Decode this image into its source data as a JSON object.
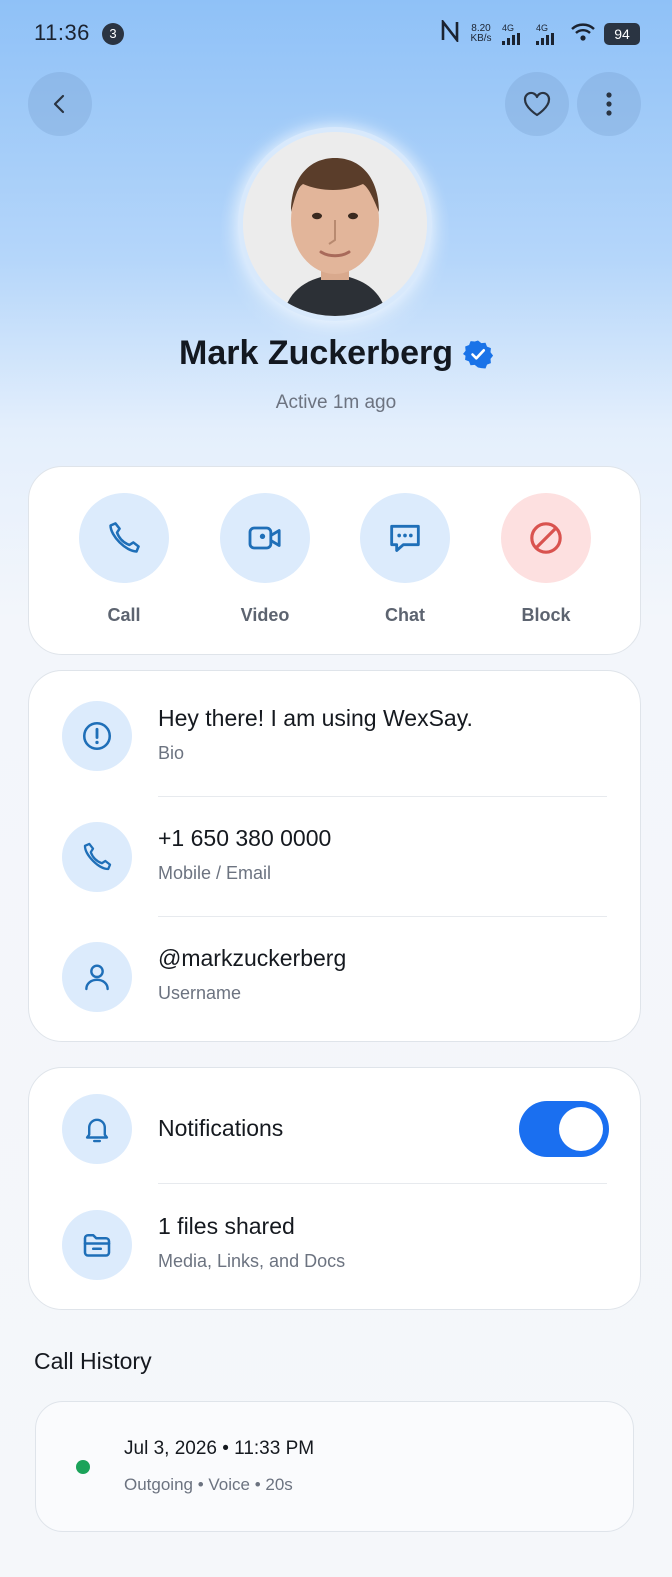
{
  "status_bar": {
    "time": "11:36",
    "notification_count": "3",
    "speed_value": "8.20",
    "speed_unit": "KB/s",
    "signal1_label": "4G",
    "signal2_label": "4G",
    "battery": "94"
  },
  "header": {
    "back_icon": "chevron-left-icon",
    "favorite_icon": "heart-icon",
    "more_icon": "more-vertical-icon"
  },
  "profile": {
    "name": "Mark Zuckerberg",
    "verified": true,
    "status": "Active 1m ago"
  },
  "actions": [
    {
      "label": "Call",
      "icon": "phone-icon"
    },
    {
      "label": "Video",
      "icon": "video-icon"
    },
    {
      "label": "Chat",
      "icon": "chat-icon"
    },
    {
      "label": "Block",
      "icon": "block-icon"
    }
  ],
  "info": {
    "bio": {
      "value": "Hey there! I am using WexSay.",
      "label": "Bio"
    },
    "phone": {
      "value": "+1 650 380 0000",
      "label": "Mobile / Email"
    },
    "username": {
      "value": "@markzuckerberg",
      "label": "Username"
    }
  },
  "settings": {
    "notifications_label": "Notifications",
    "notifications_on": true,
    "files_title": "1 files shared",
    "files_sub": "Media, Links, and Docs"
  },
  "call_history": {
    "title": "Call History",
    "items": [
      {
        "datetime": "Jul 3, 2026 • 11:33 PM",
        "details": "Outgoing • Voice • 20s",
        "status_color": "#1ba35a"
      }
    ]
  },
  "colors": {
    "accent": "#1a6ff0",
    "icon_blue": "#1f6fb8",
    "block_red": "#d9534f"
  }
}
